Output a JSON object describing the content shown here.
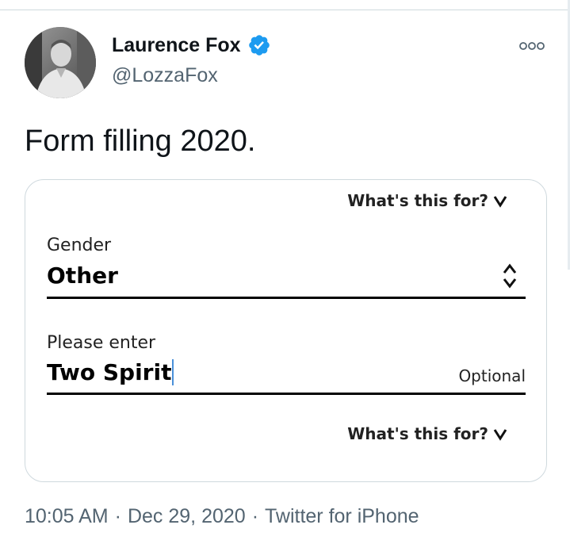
{
  "author": {
    "display_name": "Laurence Fox",
    "handle": "@LozzaFox",
    "verified": true,
    "verified_icon": "verified-badge-icon"
  },
  "tweet": {
    "text": "Form filling 2020."
  },
  "form_image": {
    "help_link_top": "What's this for?",
    "help_link_bottom": "What's this for?",
    "gender_label": "Gender",
    "gender_value": "Other",
    "enter_label": "Please enter",
    "enter_value": "Two Spirit",
    "optional_label": "Optional"
  },
  "meta": {
    "time": "10:05 AM",
    "separator": "·",
    "date": "Dec 29, 2020",
    "source": "Twitter for iPhone"
  },
  "colors": {
    "verified": "#1d9bf0",
    "secondary_text": "#536471",
    "border": "#cfd9de"
  }
}
